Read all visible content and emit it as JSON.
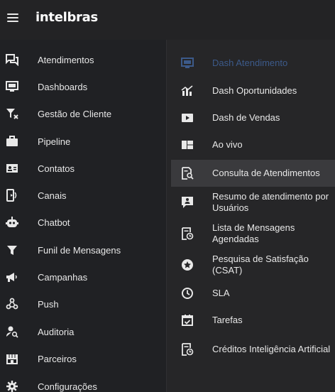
{
  "header": {
    "logo_text": "intelbras",
    "menu_icon": "hamburger-menu-icon"
  },
  "sidebar": {
    "items": [
      {
        "label": "Atendimentos",
        "icon": "chat-bubbles-icon"
      },
      {
        "label": "Dashboards",
        "icon": "monitor-icon"
      },
      {
        "label": "Gestão de Cliente",
        "icon": "filter-icon"
      },
      {
        "label": "Pipeline",
        "icon": "briefcase-icon"
      },
      {
        "label": "Contatos",
        "icon": "contact-card-icon"
      },
      {
        "label": "Canais",
        "icon": "phone-channels-icon"
      },
      {
        "label": "Chatbot",
        "icon": "robot-icon"
      },
      {
        "label": "Funil de Mensagens",
        "icon": "funnel-icon"
      },
      {
        "label": "Campanhas",
        "icon": "megaphone-icon"
      },
      {
        "label": "Push",
        "icon": "push-network-icon"
      },
      {
        "label": "Auditoria",
        "icon": "user-search-icon"
      },
      {
        "label": "Parceiros",
        "icon": "storefront-icon"
      },
      {
        "label": "Configurações",
        "icon": "gear-icon"
      }
    ]
  },
  "submenu": {
    "items": [
      {
        "label": "Dash Atendimento",
        "icon": "monitor-icon",
        "state": "disabled"
      },
      {
        "label": "Dash Oportunidades",
        "icon": "chart-trend-icon",
        "state": "normal"
      },
      {
        "label": "Dash de Vendas",
        "icon": "video-play-icon",
        "state": "normal"
      },
      {
        "label": "Ao vivo",
        "icon": "grid-layout-icon",
        "state": "normal"
      },
      {
        "label": "Consulta de Atendimentos",
        "icon": "document-search-icon",
        "state": "active"
      },
      {
        "label": "Resumo de atendimento por Usuários",
        "icon": "user-chat-icon",
        "state": "normal"
      },
      {
        "label": "Lista de Mensagens Agendadas",
        "icon": "scheduled-list-icon",
        "state": "normal"
      },
      {
        "label": "Pesquisa de Satisfação (CSAT)",
        "icon": "star-circle-icon",
        "state": "normal"
      },
      {
        "label": "SLA",
        "icon": "clock-icon",
        "state": "normal"
      },
      {
        "label": "Tarefas",
        "icon": "calendar-check-icon",
        "state": "normal"
      },
      {
        "label": "Créditos Inteligência Artificial",
        "icon": "ai-credits-icon",
        "state": "normal"
      }
    ]
  },
  "colors": {
    "background": "#202124",
    "submenu_background": "#262628",
    "active_row": "#3a3a3d",
    "disabled_text": "#3c5a8a",
    "text": "#e8e8e8"
  }
}
